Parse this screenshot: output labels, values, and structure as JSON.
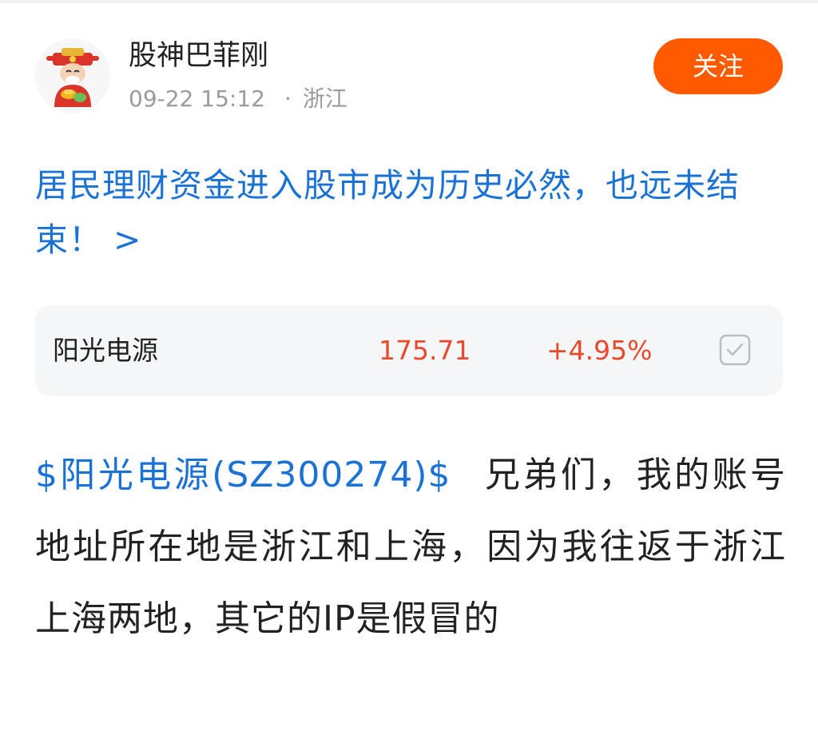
{
  "post": {
    "author": {
      "name": "股神巴菲刚",
      "avatar_icon": "caishen-avatar-icon"
    },
    "date": "09-22 15:12",
    "separator": "·",
    "location": "浙江",
    "follow_label": "关注",
    "headline": "居民理财资金进入股市成为历史必然，也远未结束！ >",
    "stock_card": {
      "name": "阳光电源",
      "price": "175.71",
      "change": "+4.95%",
      "check_icon": "checkbox-icon"
    },
    "body": {
      "stock_link": "$阳光电源(SZ300274)$",
      "text": "兄弟们，我的账号地址所在地是浙江和上海，因为我往返于浙江上海两地，其它的IP是假冒的"
    }
  },
  "colors": {
    "accent_orange": "#ff5a00",
    "link_blue": "#1a72d6",
    "rise_red": "#e8492a",
    "meta_gray": "#9b9b9b",
    "card_bg": "#f5f6f8"
  }
}
